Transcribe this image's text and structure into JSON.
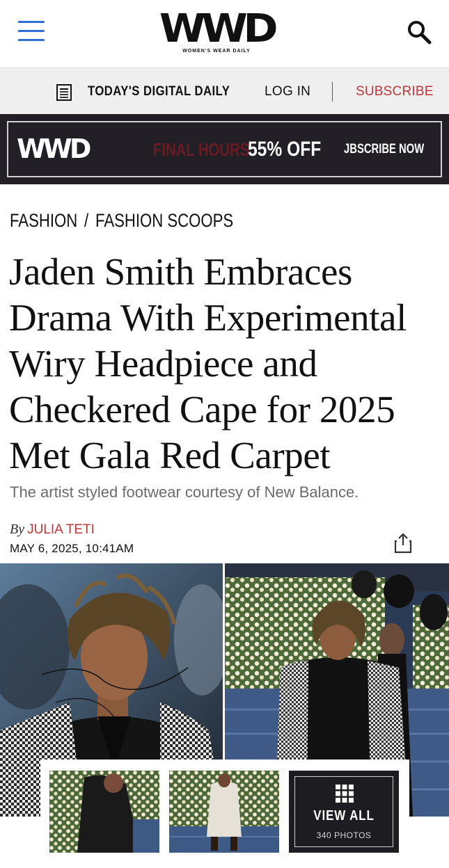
{
  "header": {
    "logo_text": "WWD",
    "logo_subtitle": "WOMEN'S WEAR DAILY",
    "menu_icon": "hamburger-menu-icon",
    "search_icon": "search-icon"
  },
  "subnav": {
    "digital_daily_label": "TODAY'S DIGITAL DAILY",
    "login_label": "LOG IN",
    "subscribe_label": "SUBSCRIBE",
    "subscribe_color": "#c0363a"
  },
  "promo": {
    "logo_text": "WWD",
    "final_hours": "FINAL HOURS",
    "offer": "55% OFF",
    "cta": "JBSCRIBE NOW"
  },
  "breadcrumb": {
    "section": "FASHION",
    "separator": "/",
    "subsection": "FASHION SCOOPS"
  },
  "article": {
    "headline": "Jaden Smith Embraces Drama With Experimental Wiry Headpiece and Checkered Cape for 2025 Met Gala Red Carpet",
    "dek": "The artist styled footwear courtesy of New Balance.",
    "byline_prefix": "By",
    "author": "JULIA TETI",
    "date": "MAY 6, 2025, 10:41AM",
    "share_icon": "share-icon"
  },
  "gallery": {
    "view_all_label": "VIEW ALL",
    "photo_count": "340 PHOTOS",
    "grid_icon": "grid-icon"
  }
}
